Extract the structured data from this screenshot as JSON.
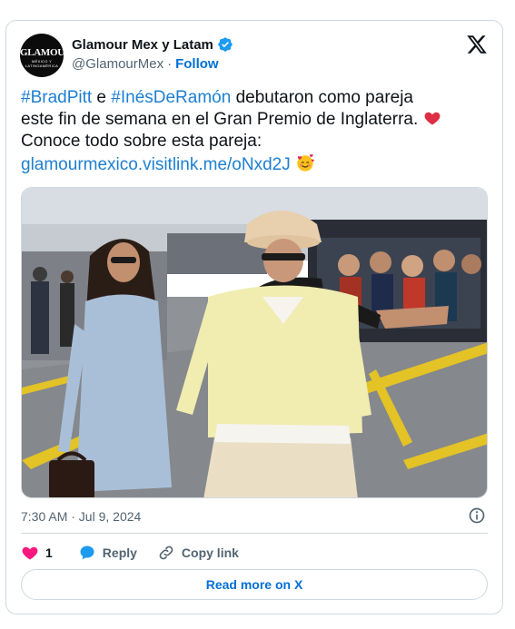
{
  "author": {
    "display_name": "Glamour Mex y Latam",
    "handle": "@GlamourMex",
    "separator": "·",
    "follow_label": "Follow",
    "avatar_text": "GLAMOUR",
    "avatar_subtext": "MÉXICO Y LATINOAMÉRICA",
    "verified_icon": "verified-badge-icon"
  },
  "tweet": {
    "hashtag1": "#BradPitt",
    "connector": " e ",
    "hashtag2": "#InésDeRamón",
    "body1": " debutaron como pareja este fin de semana en el Gran Premio de Inglaterra. ",
    "body2": "Conoce todo sobre esta pareja: ",
    "link": "glamourmexico.visitlink.me/oNxd2J",
    "emoji1": "red-heart-icon",
    "emoji2": "smiling-face-with-hearts-icon"
  },
  "meta": {
    "timestamp": "7:30 AM · Jul 9, 2024"
  },
  "actions": {
    "like_count": "1",
    "reply_label": "Reply",
    "copy_label": "Copy link"
  },
  "footer": {
    "read_more_label": "Read more on X"
  },
  "colors": {
    "accent": "#1d9bf0",
    "link": "#1d7fd1",
    "like": "#f91880",
    "muted": "#536471",
    "border": "#cfd9de"
  }
}
